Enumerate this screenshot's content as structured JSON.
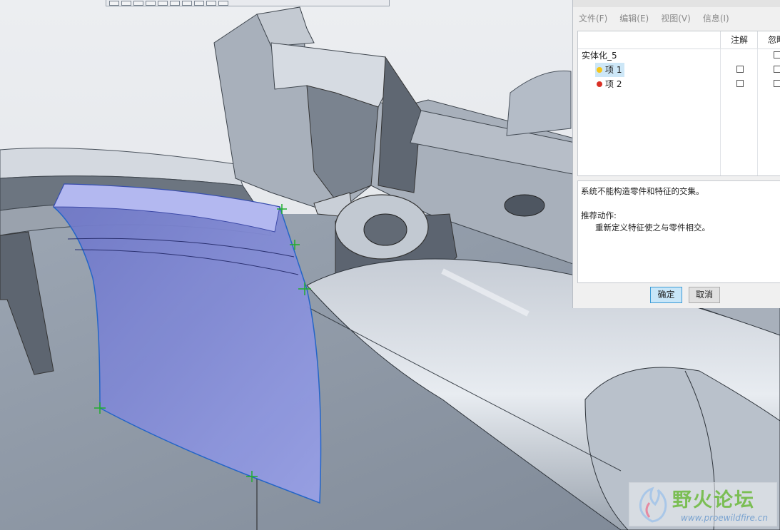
{
  "dialog": {
    "menu": [
      "文件(F)",
      "编辑(E)",
      "视图(V)",
      "信息(I)"
    ],
    "columns": [
      "注解",
      "忽略"
    ],
    "tree": {
      "root": "实体化_5",
      "items": [
        {
          "label": "项 1",
          "status_color": "#f5c518",
          "selected": true
        },
        {
          "label": "项 2",
          "status_color": "#d93025",
          "selected": false
        }
      ]
    },
    "message": {
      "error": "系统不能构造零件和特征的交集。",
      "action_heading": "推荐动作:",
      "action": "重新定义特征使之与零件相交。"
    },
    "ok_label": "确定",
    "cancel_label": "取消"
  },
  "watermark": {
    "title": "野火论坛",
    "url": "www.proewildfire.cn"
  },
  "colors": {
    "selection_face": "#8b93dc",
    "model_body": "#aeb6c1",
    "accent": "#3c9bd6"
  }
}
